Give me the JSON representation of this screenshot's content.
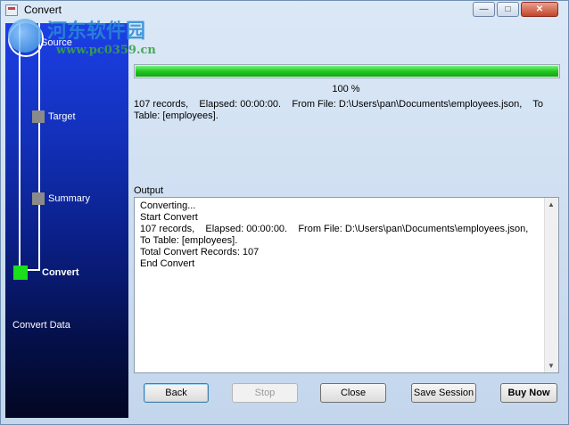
{
  "window": {
    "title": "Convert",
    "controls": [
      "—",
      "□",
      "✕"
    ]
  },
  "watermark": {
    "text": "河东软件园",
    "url": "www.pc0359.cn"
  },
  "wizard": {
    "steps": [
      {
        "label": "Source",
        "state": "done"
      },
      {
        "label": "Target",
        "state": "done"
      },
      {
        "label": "Summary",
        "state": "done"
      },
      {
        "label": "Convert",
        "state": "current"
      }
    ],
    "footer_label": "Convert Data"
  },
  "progress": {
    "value": 1.0,
    "label": "100 %"
  },
  "status": "107 records,    Elapsed: 00:00:00.    From File: D:\\Users\\pan\\Documents\\employees.json,    To Table: [employees].",
  "output": {
    "label": "Output",
    "lines": "Converting...\nStart Convert\n107 records,    Elapsed: 00:00:00.    From File: D:\\Users\\pan\\Documents\\employees.json,\nTo Table: [employees].\nTotal Convert Records: 107\nEnd Convert"
  },
  "buttons": {
    "back": "Back",
    "stop": "Stop",
    "close": "Close",
    "save_session": "Save Session",
    "buy_now": "Buy Now"
  },
  "colors": {
    "progress": "#20c820",
    "current_step": "#1adf1a",
    "sidebar_top": "#1c3fe6",
    "sidebar_bottom": "#020722"
  }
}
